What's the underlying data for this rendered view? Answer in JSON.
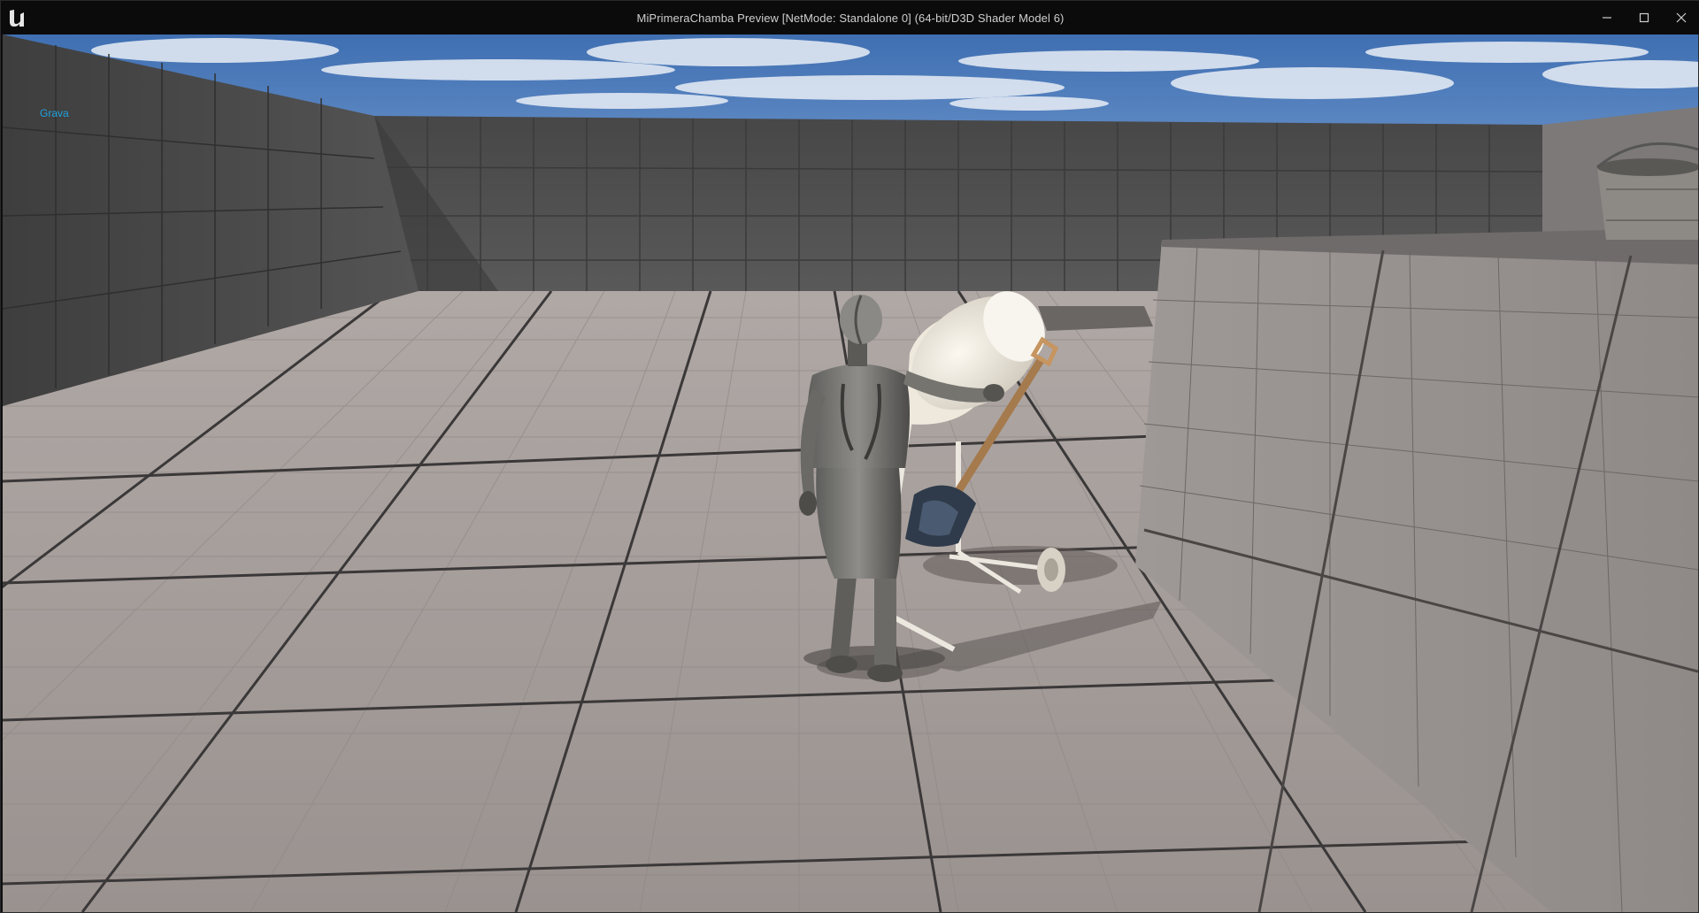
{
  "window": {
    "title": "MiPrimeraChamba Preview [NetMode: Standalone 0]  (64-bit/D3D Shader Model 6)",
    "logo_icon": "unreal-engine-logo-icon",
    "controls": {
      "minimize_icon": "minimize-icon",
      "maximize_icon": "maximize-icon",
      "close_icon": "close-icon"
    }
  },
  "viewport": {
    "hud_text": "Grava",
    "hud_color": "#1fa2df",
    "scene": {
      "sky_color": "#5d89c6",
      "wall_color": "#5a5a5a",
      "floor_color": "#a39b98",
      "character": "mannequin-character",
      "props": [
        "cement-mixer",
        "shovel",
        "metal-bucket",
        "raised-block-platform"
      ]
    }
  }
}
